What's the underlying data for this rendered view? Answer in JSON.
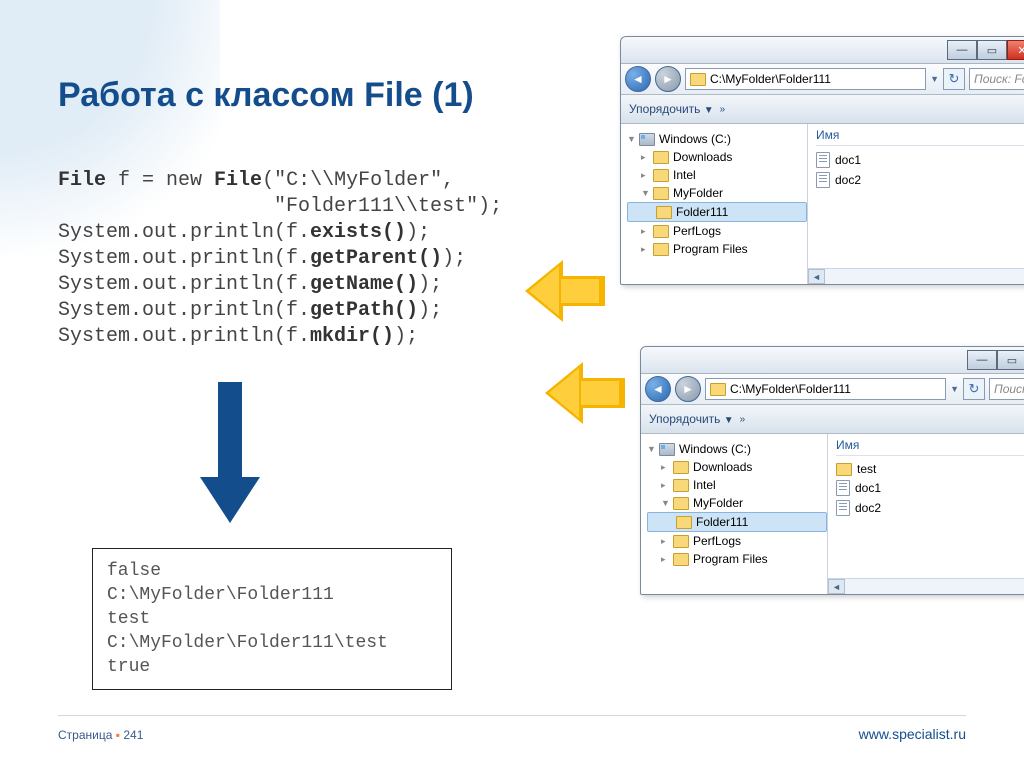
{
  "title": "Работа с классом File (1)",
  "code": {
    "l1a": "File",
    "l1b": " f = new ",
    "l1c": "File",
    "l1d": "(\"C:\\\\MyFolder\",",
    "l2": "                  \"Folder111\\\\test\");",
    "l3a": "System.out.println(f.",
    "l3b": "exists()",
    "l3c": ");",
    "l4a": "System.out.println(f.",
    "l4b": "getParent()",
    "l4c": ");",
    "l5a": "System.out.println(f.",
    "l5b": "getName()",
    "l5c": ");",
    "l6a": "System.out.println(f.",
    "l6b": "getPath()",
    "l6c": ");",
    "l7a": "System.out.println(f.",
    "l7b": "mkdir()",
    "l7c": ");"
  },
  "output": {
    "l1": "false",
    "l2": "C:\\MyFolder\\Folder111",
    "l3": "test",
    "l4": "C:\\MyFolder\\Folder111\\test",
    "l5": "true"
  },
  "win1": {
    "path": "C:\\MyFolder\\Folder111",
    "search": "Поиск: Fo",
    "organize": "Упорядочить",
    "header": "Имя",
    "tree": [
      "Windows (C:)",
      "Downloads",
      "Intel",
      "MyFolder",
      "Folder111",
      "PerfLogs",
      "Program Files"
    ],
    "files": [
      "doc1",
      "doc2"
    ]
  },
  "win2": {
    "path": "C:\\MyFolder\\Folder111",
    "search": "Поиск: Fo",
    "organize": "Упорядочить",
    "header": "Имя",
    "tree": [
      "Windows (C:)",
      "Downloads",
      "Intel",
      "MyFolder",
      "Folder111",
      "PerfLogs",
      "Program Files"
    ],
    "files": [
      "test",
      "doc1",
      "doc2"
    ]
  },
  "footer": {
    "page_label": "Страница",
    "page_num": "241",
    "url": "www.specialist.ru"
  }
}
